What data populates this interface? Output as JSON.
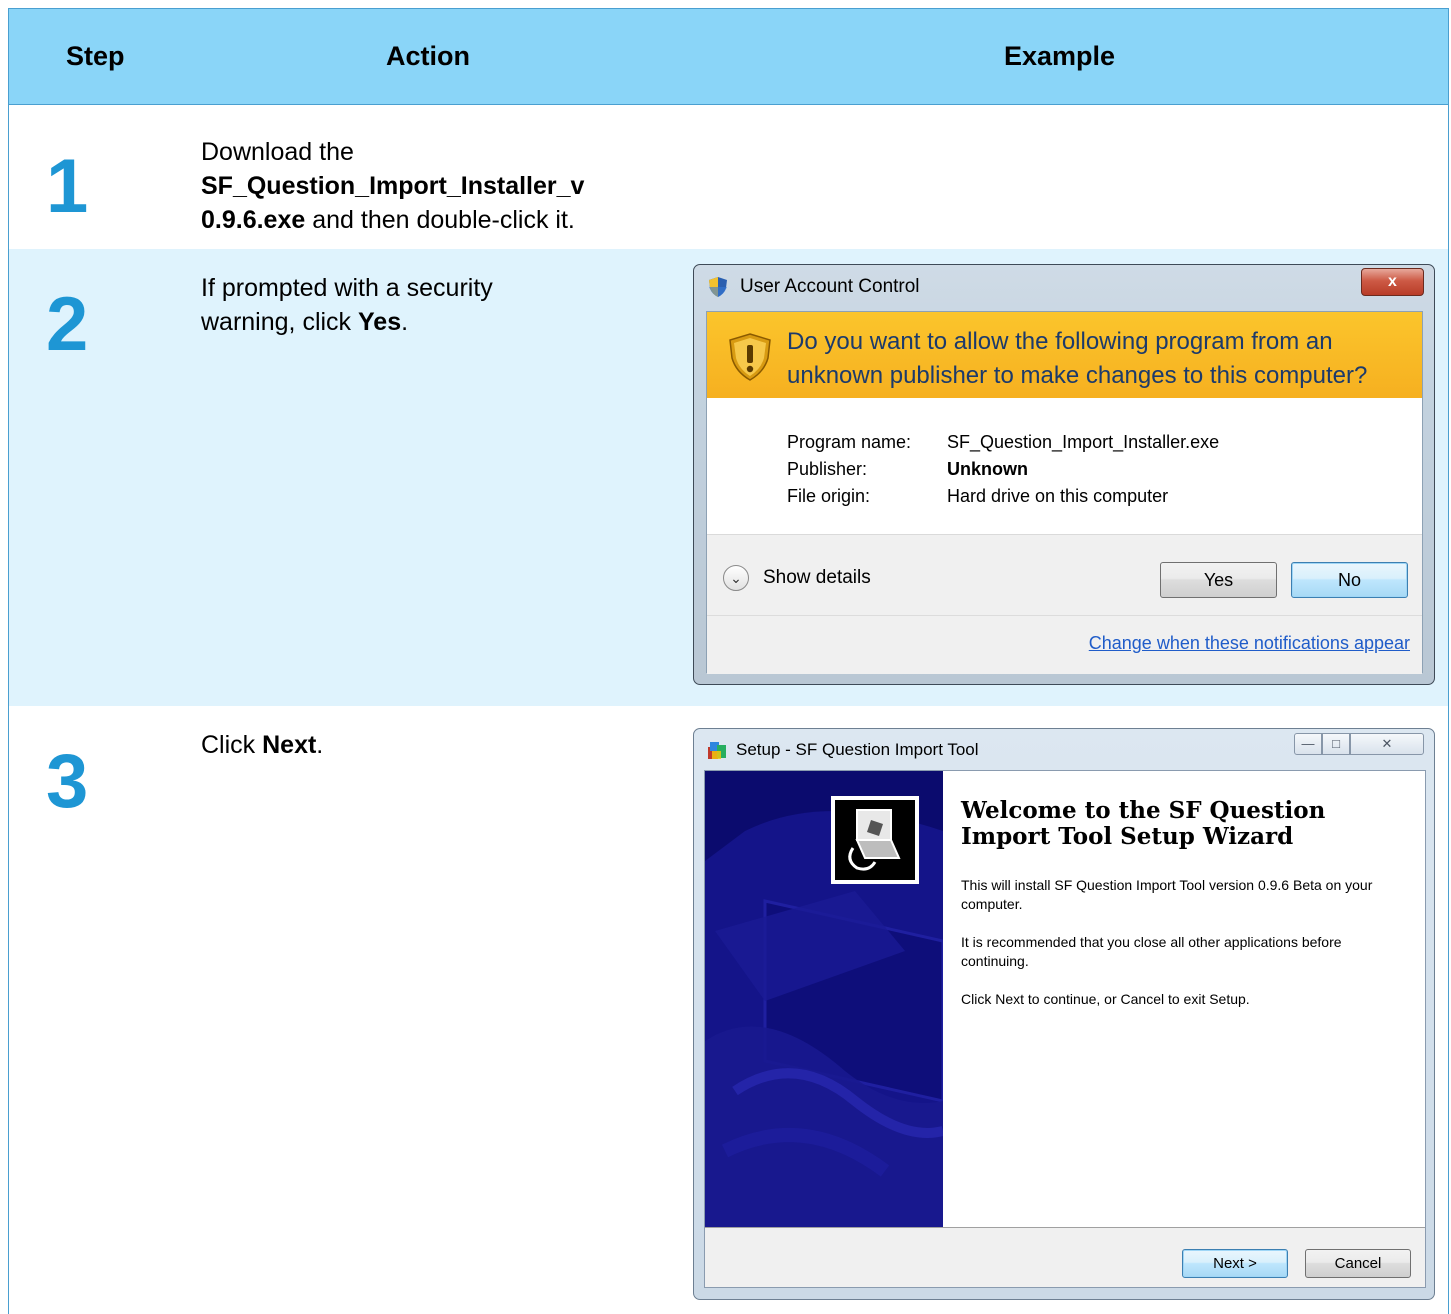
{
  "header": {
    "step": "Step",
    "action": "Action",
    "example": "Example"
  },
  "steps": [
    {
      "number": "1",
      "text_before": "Download the",
      "bold": "SF_Question_Import_Installer_v0.9.6.exe",
      "bold_line1": "SF_Question_Import_Installer_v",
      "bold_line2": "0.9.6.exe",
      "text_after": " and then double-click it."
    },
    {
      "number": "2",
      "text_line1": "If prompted with a security",
      "text_before": "warning, click ",
      "bold": "Yes",
      "text_after": "."
    },
    {
      "number": "3",
      "text_before": "Click ",
      "bold": "Next",
      "text_after": "."
    }
  ],
  "uac_dialog": {
    "title": "User Account Control",
    "close_label": "x",
    "question_line1": "Do you want to allow the following program from an",
    "question_line2": "unknown publisher to make changes to this computer?",
    "program_name_label": "Program name:",
    "program_name_value": "SF_Question_Import_Installer.exe",
    "publisher_label": "Publisher:",
    "publisher_value": "Unknown",
    "file_origin_label": "File origin:",
    "file_origin_value": "Hard drive on this computer",
    "show_details": "Show details",
    "yes_label": "Yes",
    "no_label": "No",
    "change_link": "Change when these notifications appear",
    "colors": {
      "banner": "#fbc52c",
      "link": "#1f5cc9"
    }
  },
  "setup_dialog": {
    "title": "Setup - SF Question Import Tool",
    "min_label": "—",
    "max_label": "□",
    "close_label": "✕",
    "heading": "Welcome to the SF Question Import Tool Setup Wizard",
    "para1": "This will install SF Question Import Tool version 0.9.6 Beta on your computer.",
    "para2": "It is recommended that you close all other applications before continuing.",
    "para3": "Click Next to continue, or Cancel to exit Setup.",
    "next_label": "Next >",
    "cancel_label": "Cancel",
    "colors": {
      "sidebar": "#0b0b6e"
    }
  },
  "colors": {
    "header_bg": "#8ad5f8",
    "row_alt_bg": "#dff3fd",
    "step_number": "#1e96d4",
    "border": "#4a9fd0"
  }
}
